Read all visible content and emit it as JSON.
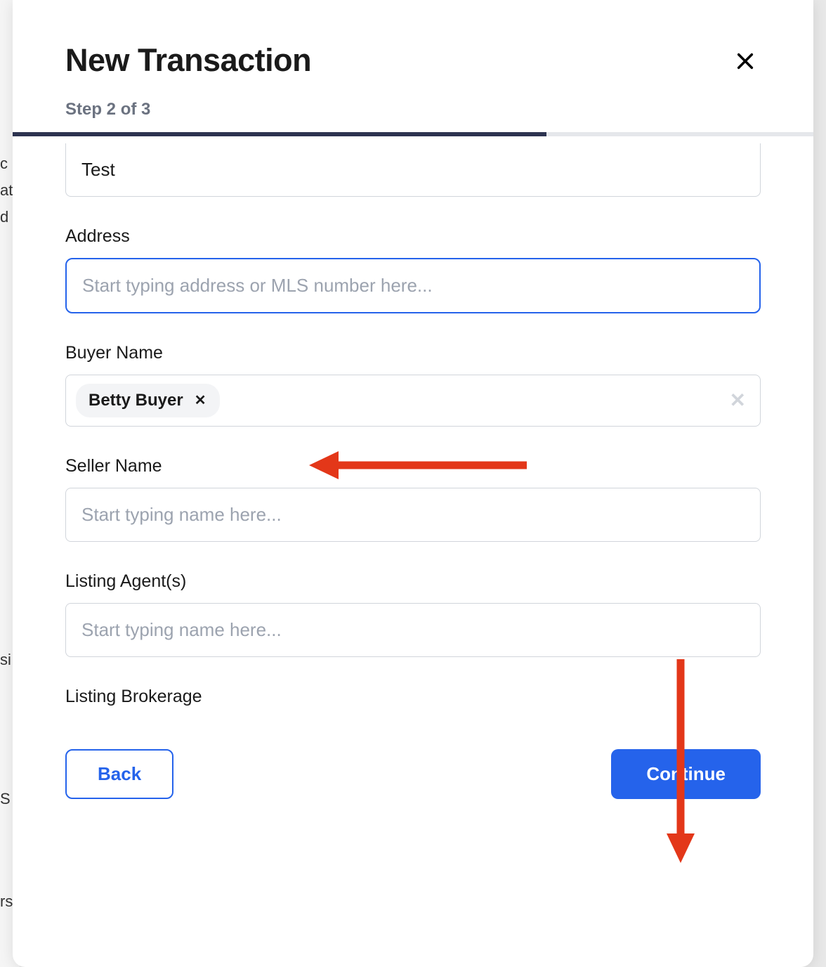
{
  "modal": {
    "title": "New Transaction",
    "step_text": "Step 2 of 3",
    "progress_percent": 66.67
  },
  "fields": {
    "name_value": "Test",
    "address_label": "Address",
    "address_placeholder": "Start typing address or MLS number here...",
    "address_value": "",
    "buyer_label": "Buyer Name",
    "buyer_tags": [
      "Betty Buyer"
    ],
    "seller_label": "Seller Name",
    "seller_placeholder": "Start typing name here...",
    "seller_value": "",
    "listing_agent_label": "Listing Agent(s)",
    "listing_agent_placeholder": "Start typing name here...",
    "listing_agent_value": "",
    "listing_brokerage_label": "Listing Brokerage"
  },
  "buttons": {
    "back": "Back",
    "continue": "Continue"
  }
}
